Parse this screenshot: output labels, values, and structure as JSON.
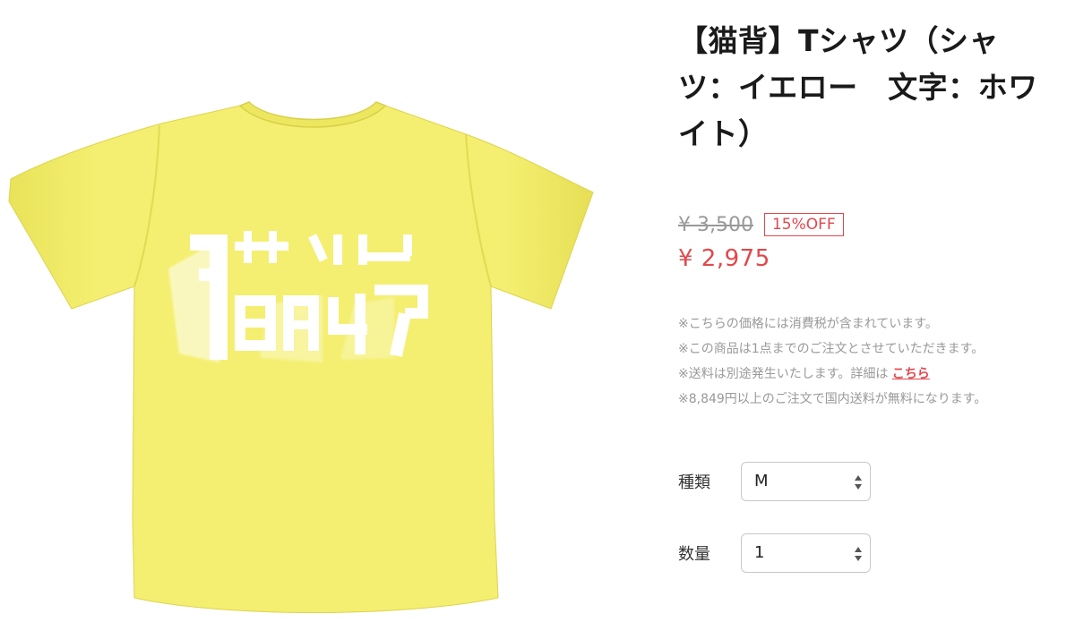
{
  "product": {
    "title": "【猫背】Tシャツ（シャツ：イエロー　文字：ホワイト）",
    "image_alt": "Yellow T-shirt with white 猫背 print",
    "original_price": "¥ 3,500",
    "discount_badge": "15%OFF",
    "sale_price": "¥ 2,975"
  },
  "notes": {
    "tax": "※こちらの価格には消費税が含まれています。",
    "limit": "※この商品は1点までのご注文とさせていただきます。",
    "shipping_prefix": "※送料は別途発生いたします。詳細は",
    "shipping_link": "こちら",
    "free_shipping": "※8,849円以上のご注文で国内送料が無料になります。"
  },
  "options": {
    "kind_label": "種類",
    "kind_value": "M",
    "qty_label": "数量",
    "qty_value": "1"
  },
  "colors": {
    "shirt": "#f3ee6b",
    "accent": "#e2474c"
  }
}
